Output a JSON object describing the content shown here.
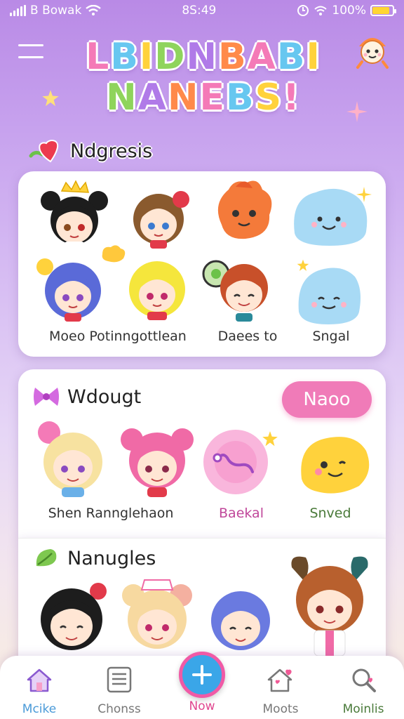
{
  "status_bar": {
    "carrier": "B Bowak",
    "time": "8S:49",
    "battery_text": "100%",
    "battery_level": 0.85
  },
  "header": {
    "title_line1": "LBIDNBABI",
    "title_line2": "NANEBS!",
    "title_colors": [
      "#f47ab7",
      "#67c7f0",
      "#ffd23c",
      "#8fd45c",
      "#b07ae8",
      "#ff8a4a",
      "#f47ab7",
      "#67c7f0",
      "#ffd23c"
    ]
  },
  "sections": [
    {
      "heading": "Ndgresis",
      "icon": "heart-icon",
      "captions": [
        "Moeo Potinngottlean",
        "Daees to",
        "Sngal"
      ]
    },
    {
      "heading": "Wdougt",
      "icon": "bow-icon",
      "button_label": "Naoo",
      "captions": [
        "Shen Ranngleh​aon",
        "Baekal",
        "Snved"
      ]
    },
    {
      "heading": "Nanugles",
      "icon": "leaf-icon",
      "captions": []
    }
  ],
  "colors": {
    "accent_pink": "#f07bb8",
    "accent_blue": "#3aa6e8",
    "caption_pink": "#c0479a",
    "caption_green": "#4a7a3a"
  },
  "bottom_nav": {
    "items": [
      {
        "label": "Mcike",
        "icon": "home-icon",
        "color": "#4a9ad8"
      },
      {
        "label": "Chonss",
        "icon": "list-icon",
        "color": "#777777"
      },
      {
        "label": "Now",
        "icon": "plus-icon",
        "color": "#e0478f"
      },
      {
        "label": "Moots",
        "icon": "house-heart-icon",
        "color": "#777777"
      },
      {
        "label": "Moinlis",
        "icon": "search-heart-icon",
        "color": "#4a7a3a"
      }
    ]
  }
}
